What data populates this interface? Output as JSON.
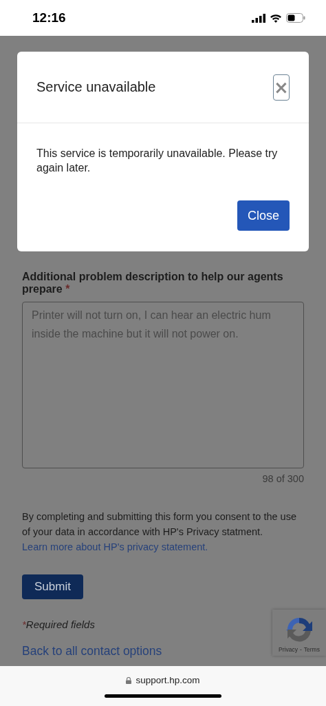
{
  "status_bar": {
    "time": "12:16"
  },
  "dialog": {
    "title": "Service unavailable",
    "close_icon": "×",
    "message": "This service is temporarily unavailable. Please try again later.",
    "button": "Close"
  },
  "form": {
    "label": "Additional problem description to help our agents prepare",
    "required_mark": "*",
    "textarea_value": "Printer will not turn on, I can hear an electric hum inside the machine but it will not power on.",
    "counter": "98 of 300",
    "consent": "By completing and submitting this form you consent to the use of your data in accordance with HP's Privacy statment.",
    "privacy_link": "Learn more about HP's privacy statement.",
    "submit": "Submit",
    "required_note_mark": "*",
    "required_note": "Required fields",
    "back_link": "Back to all contact options"
  },
  "recaptcha": {
    "privacy": "Privacy",
    "separator": "-",
    "terms": "Terms"
  },
  "browser": {
    "url": "support.hp.com"
  }
}
